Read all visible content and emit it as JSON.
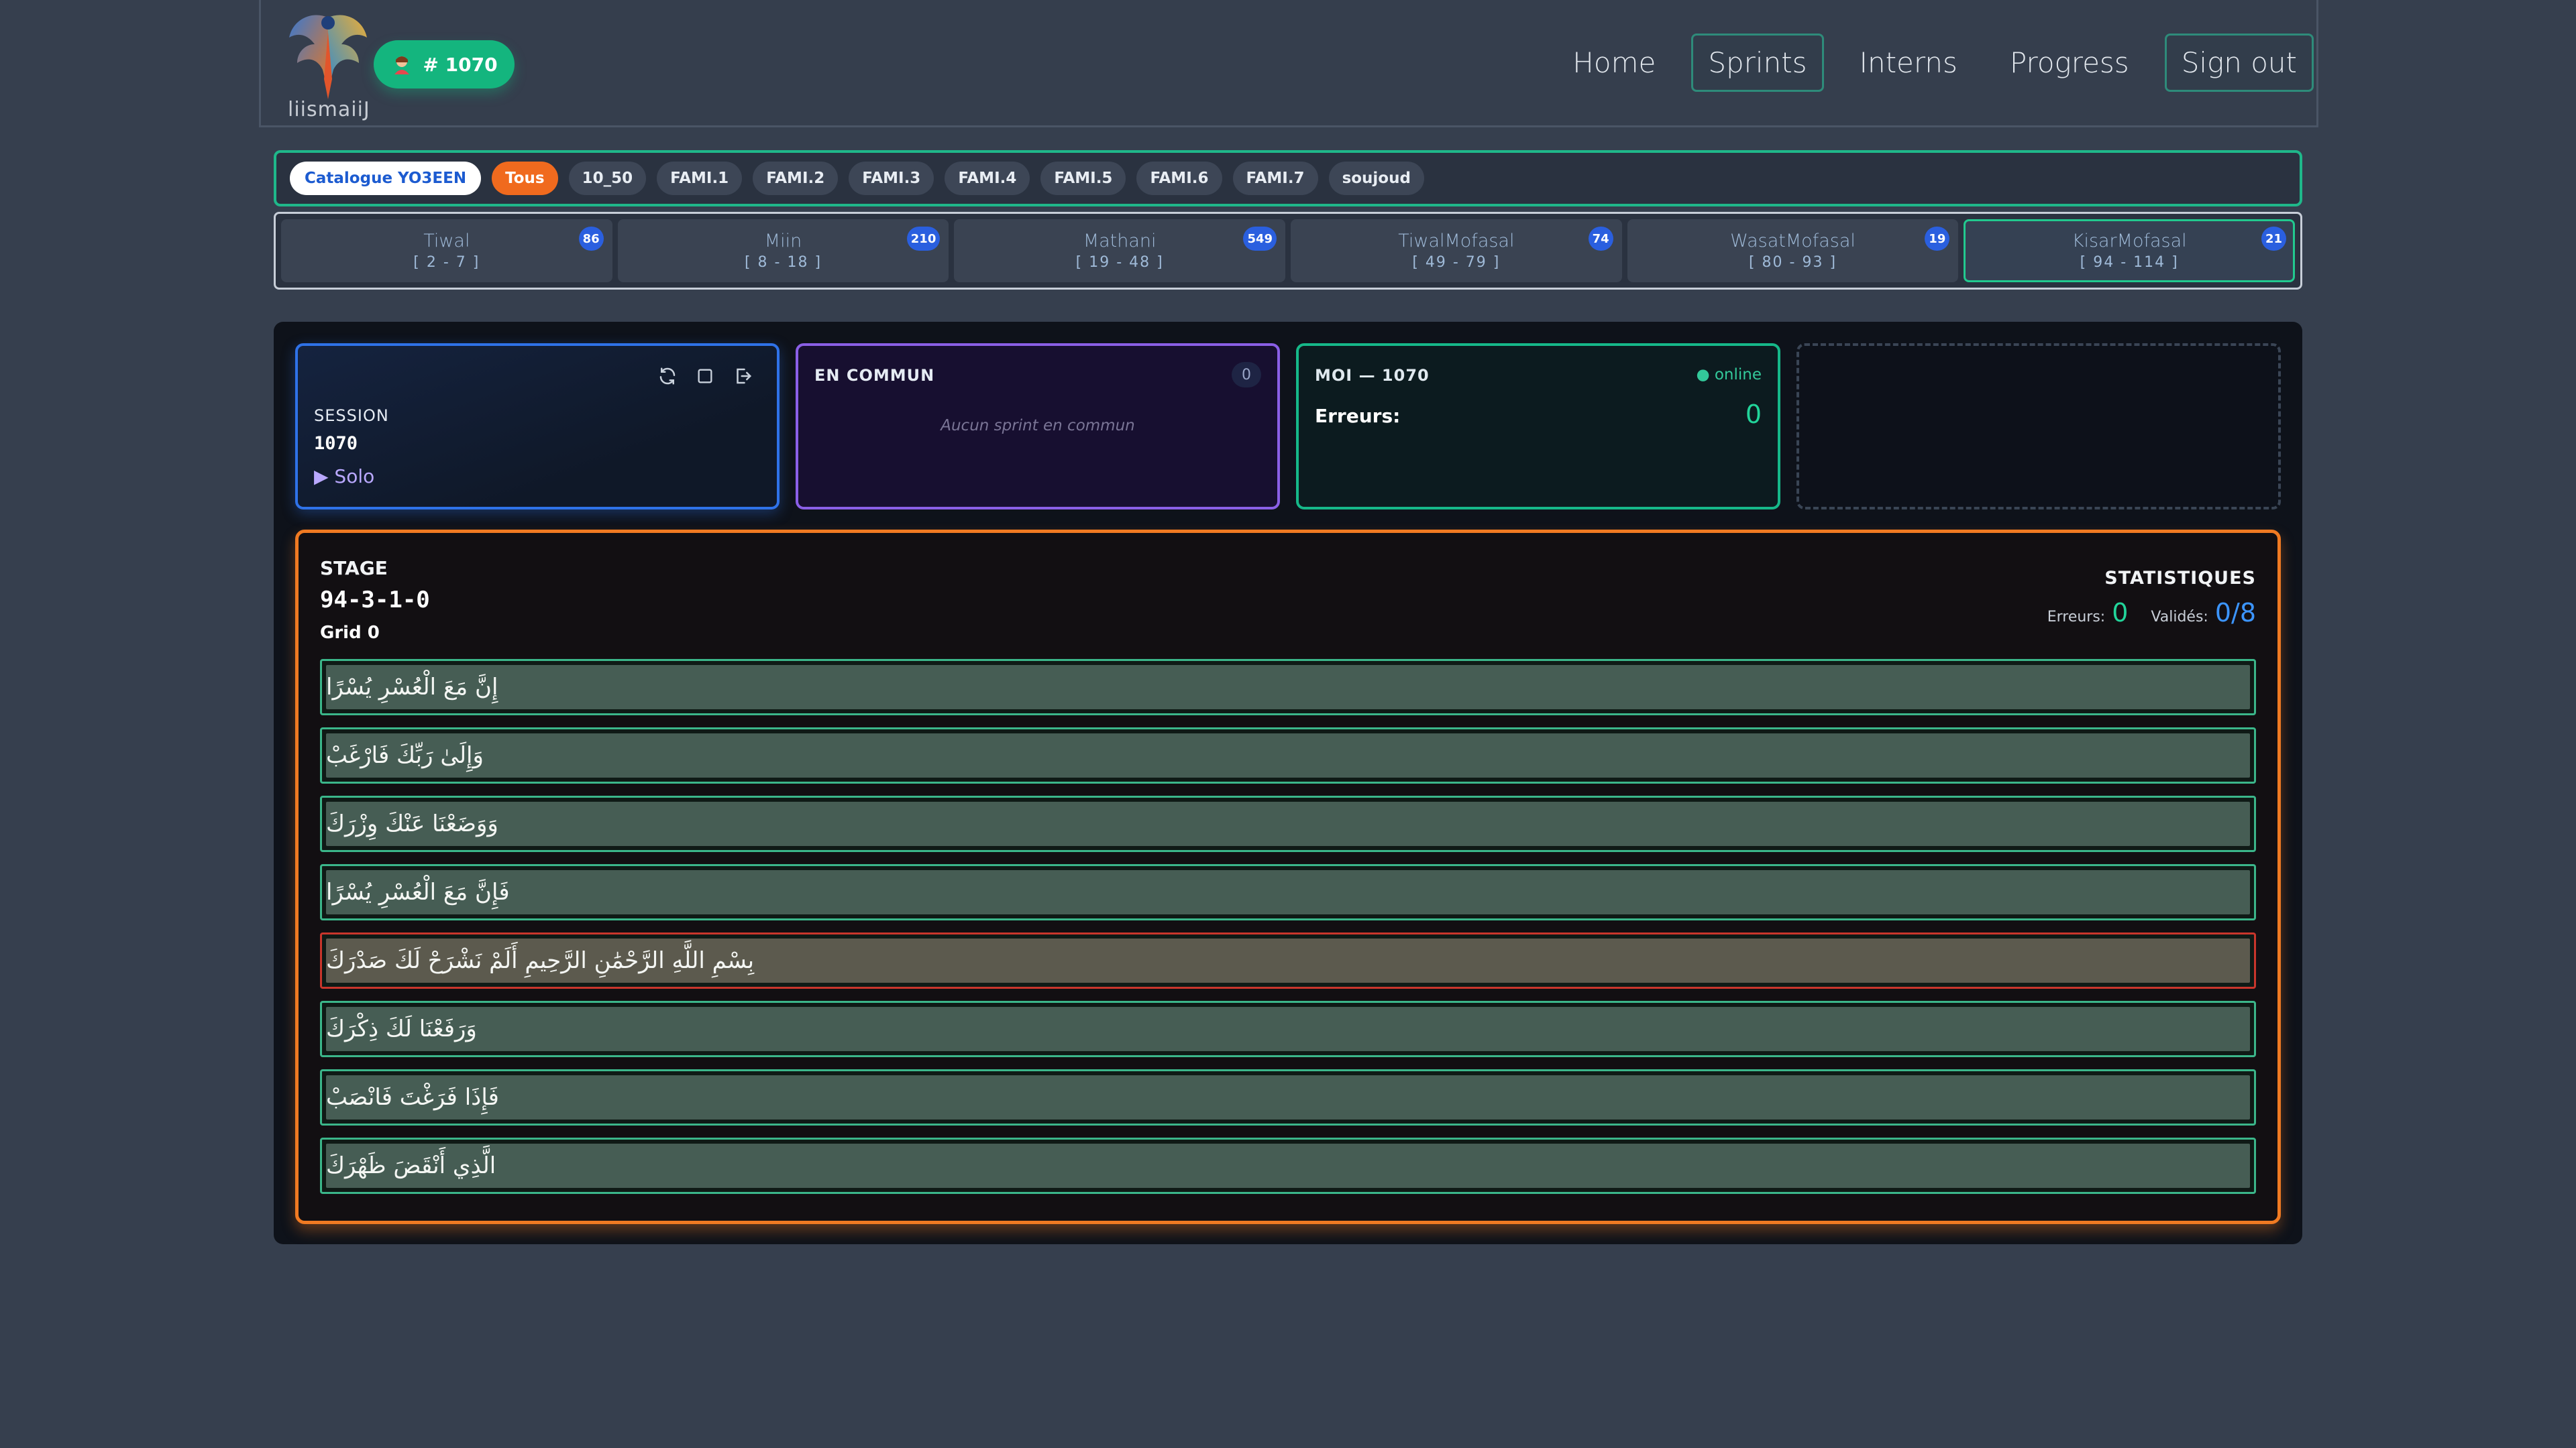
{
  "header": {
    "logo_text": "liismaiiJ",
    "user_badge": "# 1070",
    "nav": [
      {
        "label": "Home"
      },
      {
        "label": "Sprints"
      },
      {
        "label": "Interns"
      },
      {
        "label": "Progress"
      },
      {
        "label": "Sign out"
      }
    ]
  },
  "filters": {
    "catalogue": "Catalogue YO3EEN",
    "chips": [
      "Tous",
      "10_50",
      "FAMI.1",
      "FAMI.2",
      "FAMI.3",
      "FAMI.4",
      "FAMI.5",
      "FAMI.6",
      "FAMI.7",
      "soujoud"
    ],
    "active": "Tous"
  },
  "groups": [
    {
      "name": "Tiwal",
      "range": "[ 2 - 7 ]",
      "count": "86"
    },
    {
      "name": "Miin",
      "range": "[ 8 - 18 ]",
      "count": "210"
    },
    {
      "name": "Mathani",
      "range": "[ 19 - 48 ]",
      "count": "549"
    },
    {
      "name": "TiwalMofasal",
      "range": "[ 49 - 79 ]",
      "count": "74"
    },
    {
      "name": "WasatMofasal",
      "range": "[ 80 - 93 ]",
      "count": "19"
    },
    {
      "name": "KisarMofasal",
      "range": "[ 94 - 114 ]",
      "count": "21"
    }
  ],
  "session": {
    "label": "SESSION",
    "number": "1070",
    "mode": "▶ Solo"
  },
  "common": {
    "title": "EN COMMUN",
    "count": "0",
    "empty_message": "Aucun sprint en commun"
  },
  "me": {
    "title": "MOI — 1070",
    "status": "● online",
    "errors_label": "Erreurs:",
    "errors_value": "0"
  },
  "stage": {
    "label": "STAGE",
    "id": "94-3-1-0",
    "grid": "Grid 0",
    "stats_title": "STATISTIQUES",
    "errors_label": "Erreurs:",
    "errors_value": "0",
    "validated_label": "Validés:",
    "validated_value": "0/8"
  },
  "verses": [
    {
      "text": "إِنَّ مَعَ الْعُسْرِ يُسْرًا",
      "state": "ok"
    },
    {
      "text": "وَإِلَىٰ رَبِّكَ فَارْغَبْ",
      "state": "ok"
    },
    {
      "text": "وَوَضَعْنَا عَنْكَ وِزْرَكَ",
      "state": "ok"
    },
    {
      "text": "فَإِنَّ مَعَ الْعُسْرِ يُسْرًا",
      "state": "ok"
    },
    {
      "text": "بِسْمِ اللَّهِ الرَّحْمَٰنِ الرَّحِيمِ أَلَمْ نَشْرَحْ لَكَ صَدْرَكَ",
      "state": "error"
    },
    {
      "text": "وَرَفَعْنَا لَكَ ذِكْرَكَ",
      "state": "ok"
    },
    {
      "text": "فَإِذَا فَرَغْتَ فَانْصَبْ",
      "state": "ok"
    },
    {
      "text": "الَّذِي أَنْقَضَ ظَهْرَكَ",
      "state": "ok"
    }
  ],
  "colors": {
    "accent_green": "#14b57e",
    "accent_orange": "#f07a22",
    "accent_blue": "#2f72e8",
    "accent_purple": "#8a5fe6",
    "error_red": "#c8362c"
  }
}
